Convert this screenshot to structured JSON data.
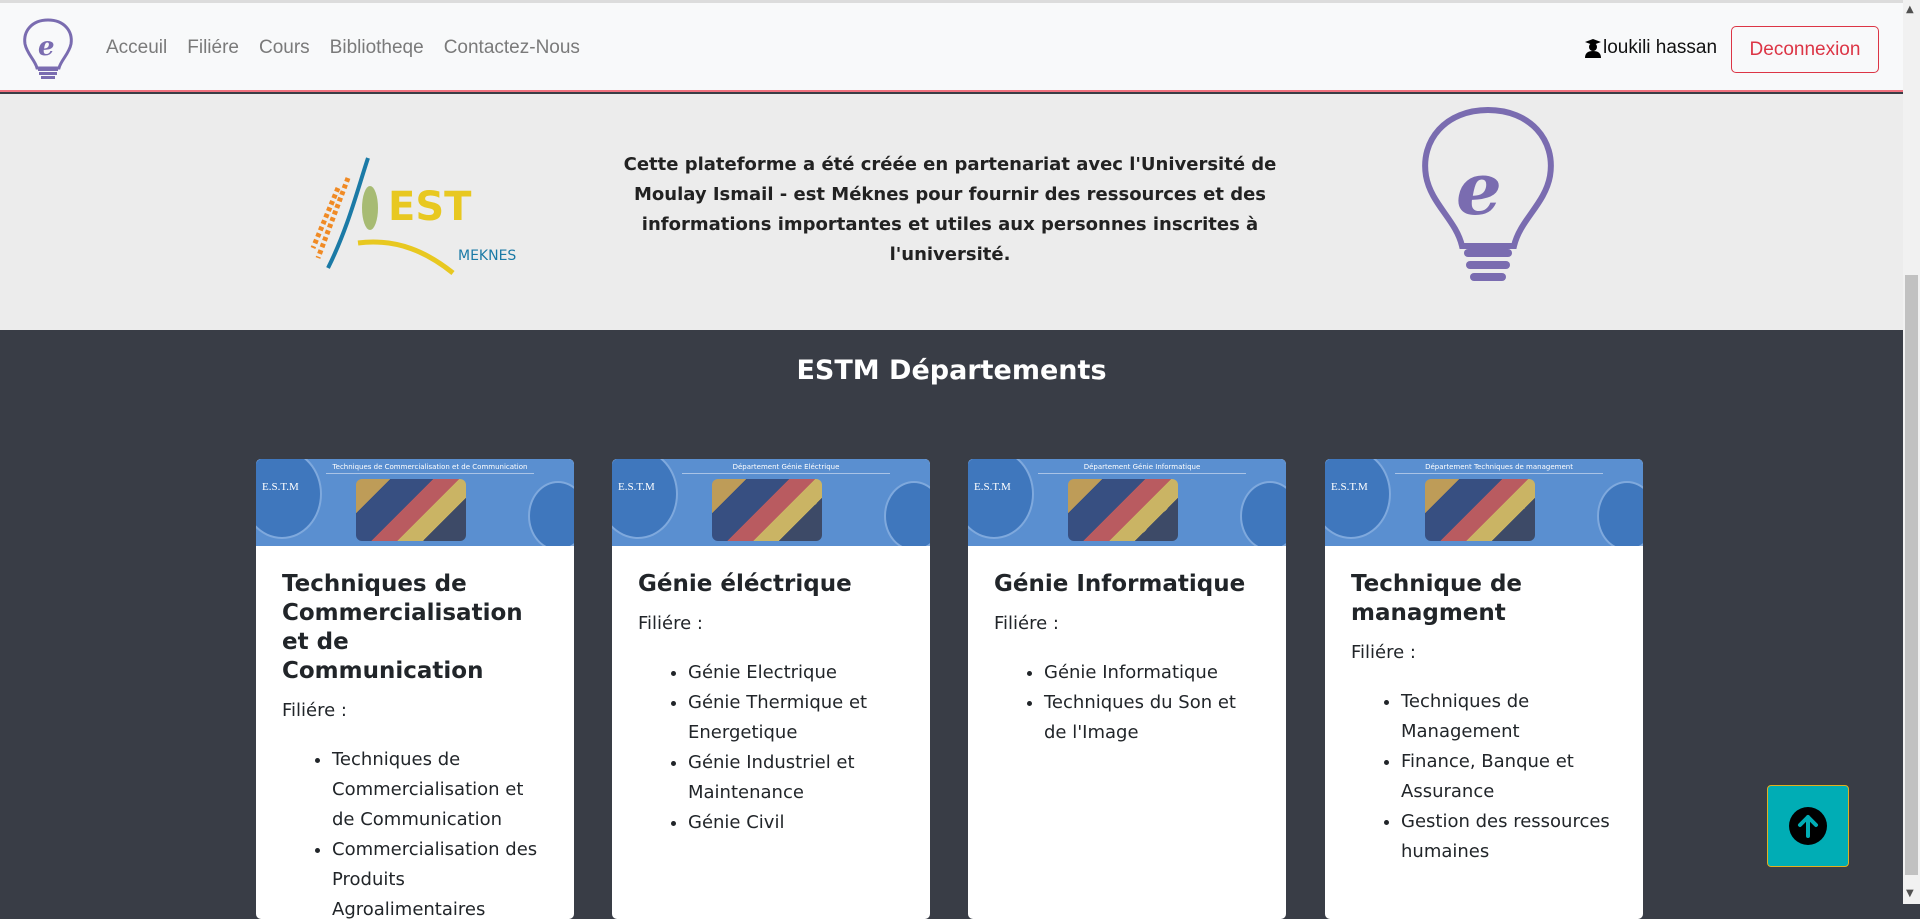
{
  "nav": {
    "links": [
      "Acceuil",
      "Filiére",
      "Cours",
      "Bibliotheqe",
      "Contactez-Nous"
    ],
    "user": "loukili hassan",
    "logout": "Deconnexion"
  },
  "hero": {
    "text": "Cette plateforme a été créée en partenariat avec l'Université de Moulay Ismail - est Méknes pour fournir des ressources et des informations importantes et utiles aux personnes inscrites à l'université.",
    "logo_text": "EST",
    "logo_sub": "MEKNES"
  },
  "section": {
    "title": "ESTM Départements"
  },
  "cards": [
    {
      "banner": "Techniques de Commercialisation et de Communication",
      "estm": "E.S.T.M",
      "title": "Techniques de Commercialisation et de Communication",
      "label": "Filiére :",
      "items": [
        "Techniques de Commercialisation et de Communication",
        "Commercialisation des Produits Agroalimentaires"
      ]
    },
    {
      "banner": "Département Génie Eléctrique",
      "estm": "E.S.T.M",
      "title": "Génie éléctrique",
      "label": "Filiére :",
      "items": [
        "Génie Electrique",
        "Génie Thermique et Energetique",
        "Génie Industriel et Maintenance",
        "Génie Civil"
      ]
    },
    {
      "banner": "Département Génie Informatique",
      "estm": "E.S.T.M",
      "title": "Génie Informatique",
      "label": "Filiére :",
      "items": [
        "Génie Informatique",
        "Techniques du Son et de l'Image"
      ]
    },
    {
      "banner": "Département Techniques de management",
      "estm": "E.S.T.M",
      "title": "Technique de managment",
      "label": "Filiére :",
      "items": [
        "Techniques de Management",
        "Finance, Banque et Assurance",
        "Gestion des ressources humaines"
      ]
    }
  ],
  "colors": {
    "accent": "#00adb5",
    "danger": "#dc3545",
    "dark": "#393d46",
    "brand": "#7a6cb0"
  }
}
